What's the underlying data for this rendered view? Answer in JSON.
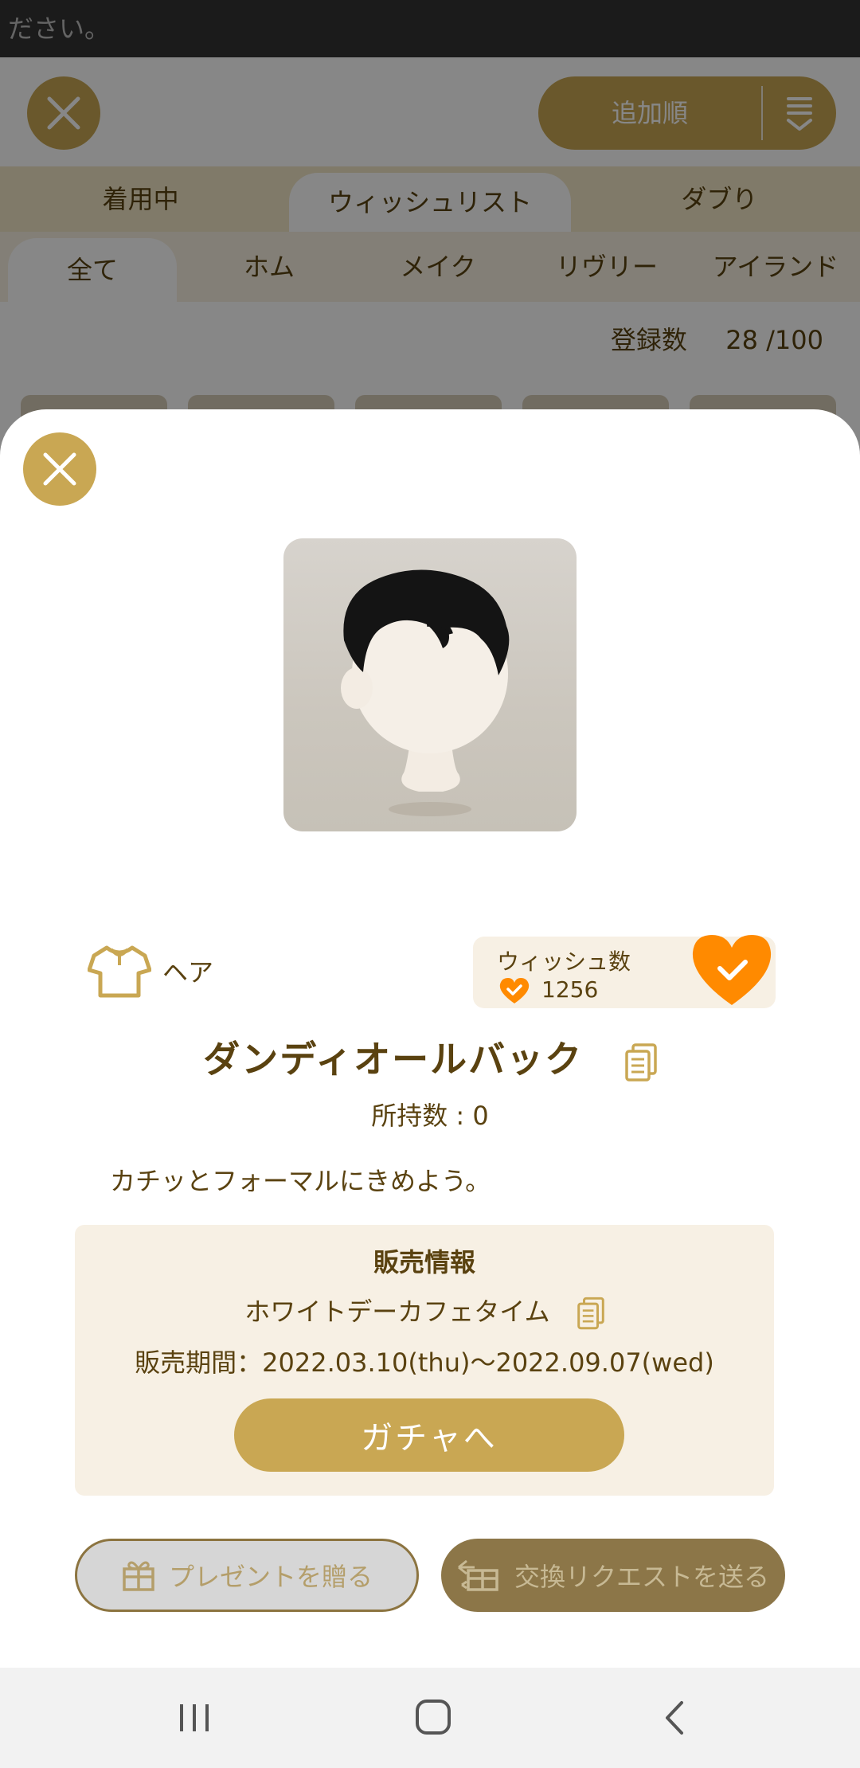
{
  "status_bar": {
    "text": "ださい。"
  },
  "background": {
    "sort_label": "追加順",
    "tabs": [
      "着用中",
      "ウィッシュリスト",
      "ダブり"
    ],
    "active_tab": "ウィッシュリスト",
    "subtabs": [
      "全て",
      "ホム",
      "メイク",
      "リヴリー",
      "アイランド"
    ],
    "active_subtab": "全て",
    "registered_label": "登録数",
    "registered_value": "28 /100"
  },
  "sheet": {
    "category_label": "ヘア",
    "wish": {
      "label": "ウィッシュ数",
      "count": "1256",
      "wished": true
    },
    "item_name": "ダンディオールバック",
    "owned": "所持数 : 0",
    "description": "カチッとフォーマルにきめよう。",
    "sale": {
      "title": "販売情報",
      "event_name": "ホワイトデーカフェタイム",
      "period": "販売期間：2022.03.10(thu)〜2022.09.07(wed)",
      "button": "ガチャへ"
    },
    "present_button": "プレゼントを贈る",
    "trade_button": "交換リクエストを送る"
  },
  "colors": {
    "accent": "#c9a753",
    "text": "#5a4210",
    "wish_orange": "#ff8a00",
    "panel": "#f7f0e4"
  },
  "icons": [
    "close-icon",
    "sort-icon",
    "shirt-icon",
    "heart-icon",
    "copy-icon",
    "gift-icon",
    "exchange-icon",
    "recents-icon",
    "home-icon",
    "back-icon"
  ]
}
